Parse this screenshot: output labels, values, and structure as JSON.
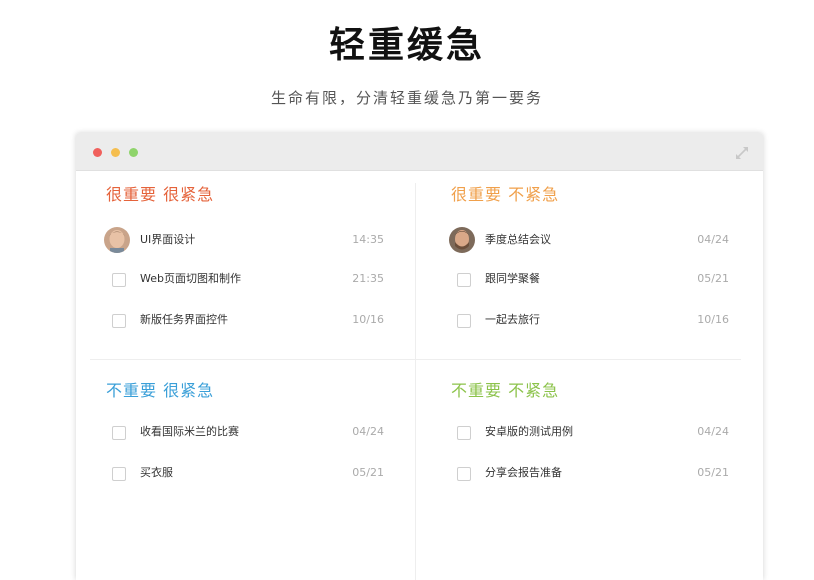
{
  "hero": {
    "title": "轻重缓急",
    "subtitle": "生命有限，分清轻重缓急乃第一要务"
  },
  "colors": {
    "urgent_important": "#e5633b",
    "important_not_urgent": "#f0a04b",
    "urgent_not_important": "#3a9fd8",
    "not_urgent_not_important": "#8cc34b"
  },
  "quadrants": [
    {
      "title": "很重要 很紧急",
      "tasks": [
        {
          "label": "UI界面设计",
          "date": "14:35",
          "avatar": true
        },
        {
          "label": "Web页面切图和制作",
          "date": "21:35"
        },
        {
          "label": "新版任务界面控件",
          "date": "10/16"
        }
      ]
    },
    {
      "title": "很重要 不紧急",
      "tasks": [
        {
          "label": "季度总结会议",
          "date": "04/24",
          "avatar": true
        },
        {
          "label": "跟同学聚餐",
          "date": "05/21"
        },
        {
          "label": "一起去旅行",
          "date": "10/16"
        }
      ]
    },
    {
      "title": "不重要 很紧急",
      "tasks": [
        {
          "label": "收看国际米兰的比赛",
          "date": "04/24"
        },
        {
          "label": "买衣服",
          "date": "05/21"
        }
      ]
    },
    {
      "title": "不重要 不紧急",
      "tasks": [
        {
          "label": "安卓版的测试用例",
          "date": "04/24"
        },
        {
          "label": "分享会报告准备",
          "date": "05/21"
        }
      ]
    }
  ]
}
